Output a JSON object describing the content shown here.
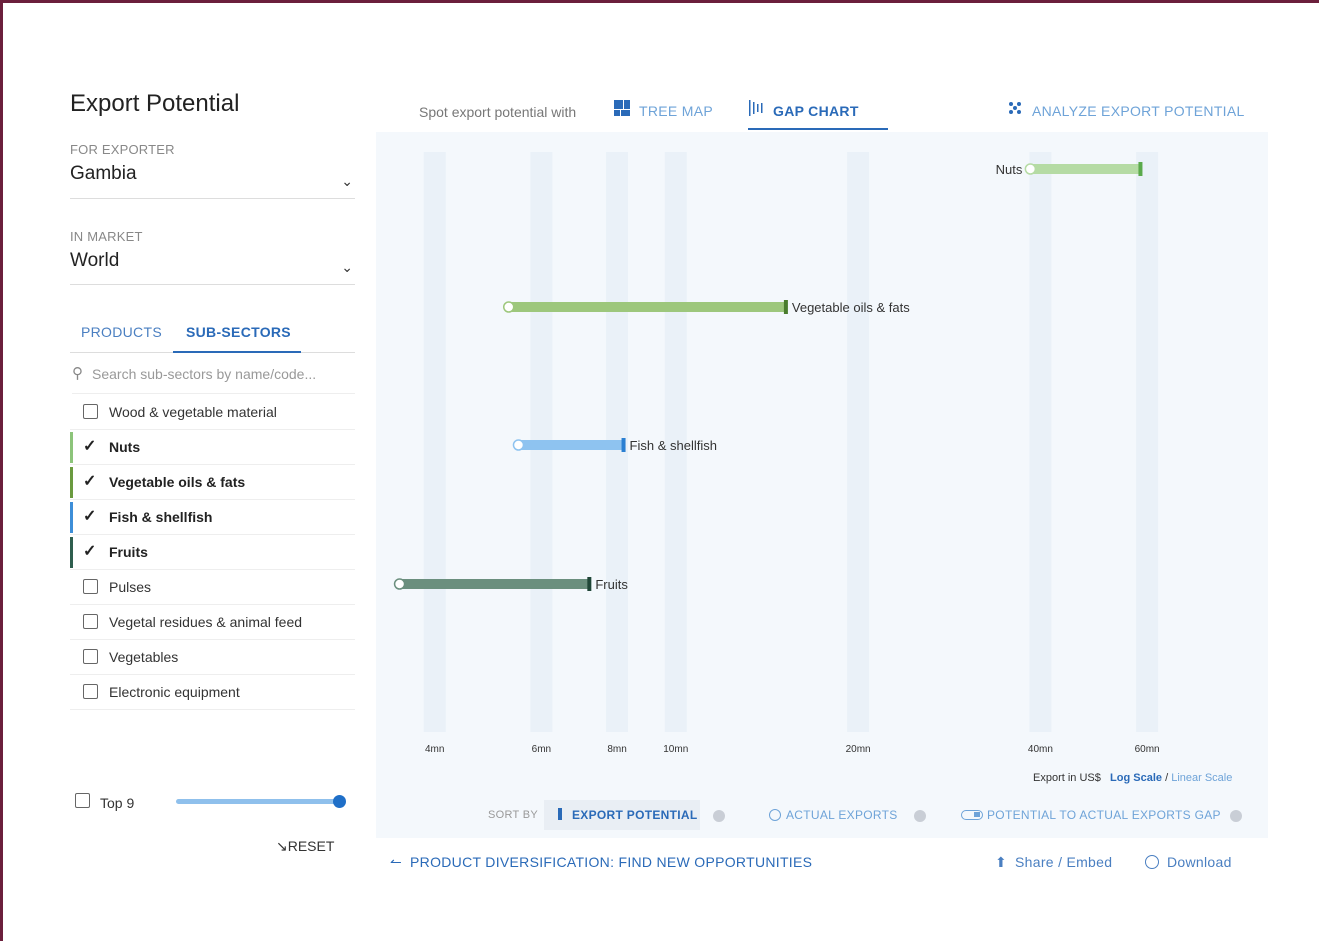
{
  "title": "Export Potential",
  "exporter": {
    "label": "FOR EXPORTER",
    "value": "Gambia"
  },
  "market": {
    "label": "IN MARKET",
    "value": "World"
  },
  "tabs": {
    "products": "PRODUCTS",
    "subsectors": "SUB-SECTORS"
  },
  "search": {
    "placeholder": "Search sub-sectors by name/code..."
  },
  "subsectors": [
    {
      "label": "Wood & vegetable material",
      "selected": false
    },
    {
      "label": "Nuts",
      "selected": true,
      "color": "#8cc47a"
    },
    {
      "label": "Vegetable oils & fats",
      "selected": true,
      "color": "#6a9a3f"
    },
    {
      "label": "Fish & shellfish",
      "selected": true,
      "color": "#3d8ed8"
    },
    {
      "label": "Fruits",
      "selected": true,
      "color": "#2e5e4e"
    },
    {
      "label": "Pulses",
      "selected": false
    },
    {
      "label": "Vegetal residues & animal feed",
      "selected": false
    },
    {
      "label": "Vegetables",
      "selected": false
    },
    {
      "label": "Electronic equipment",
      "selected": false
    }
  ],
  "top": {
    "label": "Top 9",
    "slider_fraction": 1.0
  },
  "reset_label": "RESET",
  "header": {
    "spot_text": "Spot export potential with",
    "treemap": "TREE MAP",
    "gapchart": "GAP CHART",
    "analyze": "ANALYZE EXPORT POTENTIAL"
  },
  "chart_data": {
    "type": "gap",
    "x_scale": "log",
    "x_ticks": [
      "4mn",
      "6mn",
      "8mn",
      "10mn",
      "20mn",
      "40mn",
      "60mn"
    ],
    "x_tick_values": [
      4,
      6,
      8,
      10,
      20,
      40,
      60
    ],
    "xlim": [
      3.2,
      95
    ],
    "unit": "mn US$",
    "series": [
      {
        "name": "Nuts",
        "actual": 38.5,
        "potential": 58.5,
        "color": "#b5dba4",
        "marker": "#5aaa4b",
        "label_side": "left"
      },
      {
        "name": "Vegetable oils & fats",
        "actual": 5.3,
        "potential": 15.2,
        "color": "#9dc77c",
        "marker": "#4a7d2e",
        "label_side": "right"
      },
      {
        "name": "Fish & shellfish",
        "actual": 5.5,
        "potential": 8.2,
        "color": "#8ec3f0",
        "marker": "#2a7fd2",
        "label_side": "right"
      },
      {
        "name": "Fruits",
        "actual": 3.5,
        "potential": 7.2,
        "color": "#6b8f7e",
        "marker": "#1f4637",
        "label_side": "right"
      }
    ]
  },
  "axis_note": {
    "prefix": "Export in US$",
    "log": "Log Scale",
    "sep": "/",
    "linear": "Linear Scale"
  },
  "sort": {
    "label": "SORT BY",
    "export_potential": "EXPORT POTENTIAL",
    "actual_exports": "ACTUAL EXPORTS",
    "gap": "POTENTIAL TO ACTUAL EXPORTS GAP"
  },
  "footer": {
    "diversification": "PRODUCT DIVERSIFICATION: FIND NEW OPPORTUNITIES",
    "share": "Share / Embed",
    "download": "Download"
  }
}
